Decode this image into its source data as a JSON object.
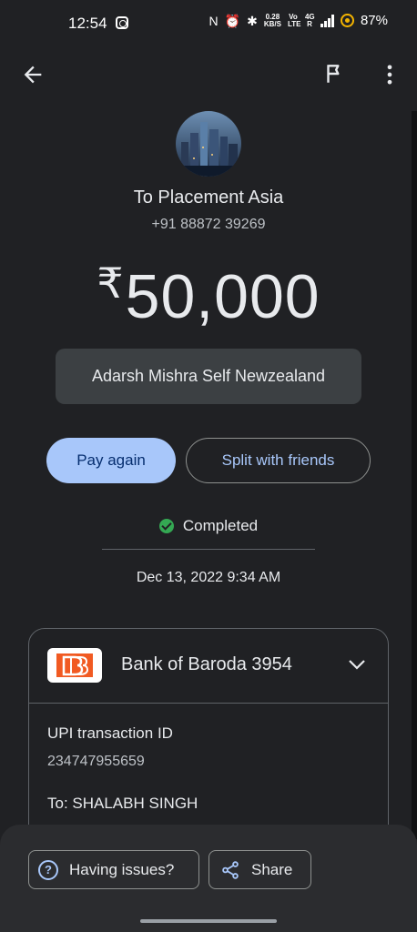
{
  "status_bar": {
    "time": "12:54",
    "net_speed_value": "0.28",
    "net_speed_unit": "KB/S",
    "volte_label": "Vo LTE",
    "network_label": "4G R",
    "battery": "87%"
  },
  "app_bar": {
    "back_icon": "arrow-left-icon",
    "report_icon": "flag-icon",
    "more_icon": "more-vert-icon"
  },
  "payee": {
    "name": "To Placement Asia",
    "phone": "+91 88872 39269"
  },
  "amount": {
    "currency": "₹",
    "value": "50,000"
  },
  "note": "Adarsh Mishra Self Newzealand",
  "actions": {
    "pay_again": "Pay again",
    "split": "Split with friends"
  },
  "status": {
    "text": "Completed",
    "color": "#34a853"
  },
  "date": "Dec 13, 2022 9:34 AM",
  "details": {
    "bank_name": "Bank of Baroda 3954",
    "upi_label": "UPI transaction ID",
    "upi_id": "234747955659",
    "to_label": "To: SHALABH SINGH"
  },
  "bottom": {
    "issues": "Having issues?",
    "share": "Share"
  },
  "colors": {
    "background": "#202124",
    "accent": "#a8c7fa",
    "bank_brand": "#f15a22"
  }
}
